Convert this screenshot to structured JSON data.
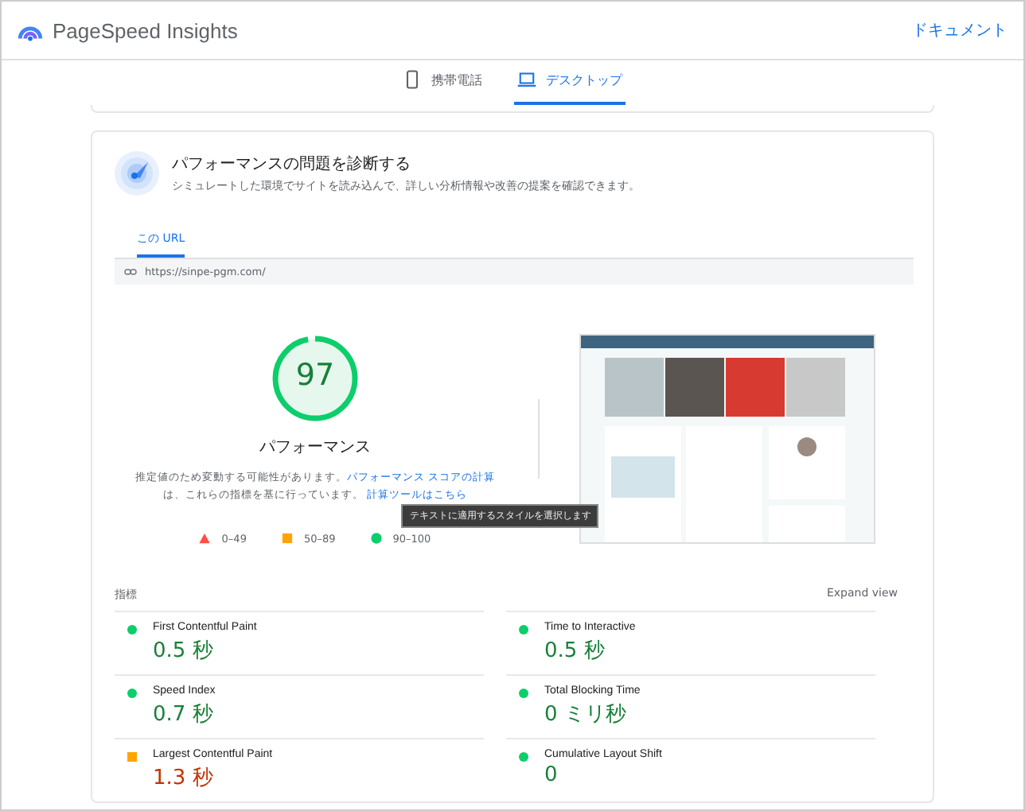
{
  "header": {
    "title": "PageSpeed Insights",
    "link": "ドキュメント"
  },
  "tabs": [
    {
      "label": "携帯電話",
      "kind": "phone",
      "selected": false
    },
    {
      "label": "デスクトップ",
      "kind": "laptop",
      "selected": true
    }
  ],
  "diagnose": {
    "title": "パフォーマンスの問題を診断する",
    "subtitle": "シミュレートした環境でサイトを読み込んで、詳しい分析情報や改善の提案を確認できます。",
    "tabs": [
      {
        "label": "この URL",
        "selected": true
      }
    ],
    "url": "https://sinpe-pgm.com/"
  },
  "score": {
    "value": "97",
    "level": 0.97,
    "label": "パフォーマンス",
    "note": "推定値のため変動する可能性があります。",
    "note_link": "パフォーマンス スコアの計算",
    "note2": "は、これらの指標を基に行っています。",
    "note_link2": "計算ツールはこちら",
    "tooltip": "テキストに適用するスタイルを選択します"
  },
  "legend": [
    {
      "kind": "fail",
      "label": "0–49"
    },
    {
      "kind": "average",
      "label": "50–89"
    },
    {
      "kind": "pass",
      "label": "90–100"
    }
  ],
  "metrics_heading": "指標",
  "expand": "Expand view",
  "metrics": [
    {
      "name": "First Contentful Paint",
      "value": "0.5 秒",
      "kind": "pass"
    },
    {
      "name": "Time to Interactive",
      "value": "0.5 秒",
      "kind": "pass"
    },
    {
      "name": "Speed Index",
      "value": "0.7 秒",
      "kind": "pass"
    },
    {
      "name": "Total Blocking Time",
      "value": "0 ミリ秒",
      "kind": "pass"
    },
    {
      "name": "Largest Contentful Paint",
      "value": "1.3 秒",
      "kind": "average"
    },
    {
      "name": "Cumulative Layout Shift",
      "value": "0",
      "kind": "pass"
    }
  ]
}
